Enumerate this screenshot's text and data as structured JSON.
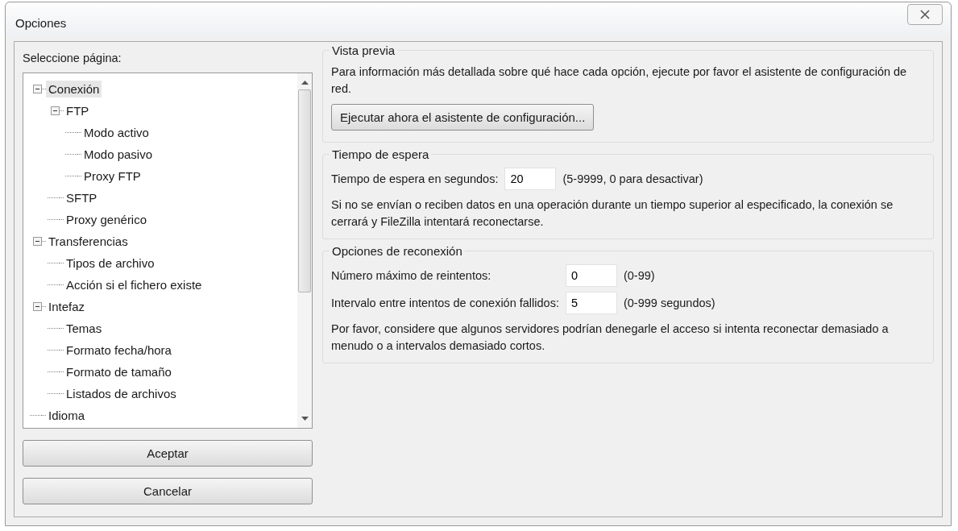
{
  "window": {
    "title": "Opciones"
  },
  "sidebar": {
    "label": "Seleccione página:",
    "tree": [
      {
        "label": "Conexión",
        "selected": true,
        "expanded": true,
        "children": [
          {
            "label": "FTP",
            "selected": false,
            "expanded": true,
            "children": [
              {
                "label": "Modo activo",
                "selected": false
              },
              {
                "label": "Modo pasivo",
                "selected": false
              },
              {
                "label": "Proxy FTP",
                "selected": false
              }
            ]
          },
          {
            "label": "SFTP",
            "selected": false
          },
          {
            "label": "Proxy genérico",
            "selected": false
          }
        ]
      },
      {
        "label": "Transferencias",
        "selected": false,
        "expanded": true,
        "children": [
          {
            "label": "Tipos de archivo",
            "selected": false
          },
          {
            "label": "Acción si el fichero existe",
            "selected": false
          }
        ]
      },
      {
        "label": "Intefaz",
        "selected": false,
        "expanded": true,
        "children": [
          {
            "label": "Temas",
            "selected": false
          },
          {
            "label": "Formato fecha/hora",
            "selected": false
          },
          {
            "label": "Formato de tamaño",
            "selected": false
          },
          {
            "label": "Listados de archivos",
            "selected": false
          }
        ]
      },
      {
        "label": "Idioma",
        "selected": false
      }
    ]
  },
  "buttons": [
    "Aceptar",
    "Cancelar"
  ],
  "groups": [
    {
      "kind": "preview",
      "title": "Vista previa",
      "text": "Para información más detallada sobre qué hace cada opción, ejecute por favor el asistente de configuración de red.",
      "button": "Ejecutar ahora el asistente de configuración..."
    },
    {
      "kind": "fields",
      "title": "Tiempo de espera",
      "fields": [
        {
          "label": "Tiempo de espera en segundos:",
          "value": "20",
          "hint": "(5-9999, 0 para desactivar)"
        }
      ],
      "note": "Si no se envían o reciben datos en una operación durante un tiempo superior al especificado, la conexión se cerrará y FileZilla intentará reconectarse."
    },
    {
      "kind": "fields",
      "title": "Opciones de reconexión",
      "fields": [
        {
          "label": "Número máximo de reintentos:",
          "value": "0",
          "hint": "(0-99)"
        },
        {
          "label": "Intervalo entre intentos de conexión fallidos:",
          "value": "5",
          "hint": "(0-999 segundos)"
        }
      ],
      "note": "Por favor, considere que algunos servidores podrían denegarle el acceso si intenta reconectar demasiado a menudo o a intervalos demasiado cortos."
    }
  ]
}
